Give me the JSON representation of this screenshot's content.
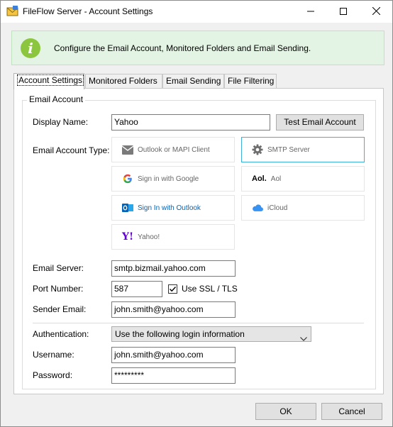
{
  "window": {
    "title": "FileFlow Server - Account Settings",
    "icons": {
      "app": "envelope-icon",
      "minimize": "minimize-icon",
      "maximize": "maximize-icon",
      "close": "close-icon"
    }
  },
  "banner": {
    "icon": "info-icon",
    "icon_glyph": "i",
    "text": "Configure the Email Account, Monitored Folders and Email Sending."
  },
  "tabs": [
    {
      "label": "Account Settings",
      "active": true
    },
    {
      "label": "Monitored Folders",
      "active": false
    },
    {
      "label": "Email Sending",
      "active": false
    },
    {
      "label": "File Filtering",
      "active": false
    }
  ],
  "email_account": {
    "group_label": "Email Account",
    "display_name_label": "Display Name:",
    "display_name_value": "Yahoo",
    "test_button_label": "Test Email Account",
    "account_type_label": "Email Account Type:",
    "account_types": [
      {
        "label": "Outlook or MAPI Client",
        "icon": "envelope-icon",
        "selected": false
      },
      {
        "label": "SMTP Server",
        "icon": "gear-icon",
        "selected": true
      },
      {
        "label": "Sign in with Google",
        "icon": "google-icon",
        "selected": false
      },
      {
        "label": "Aol",
        "icon": "aol-icon",
        "icon_text": "Aol.",
        "selected": false
      },
      {
        "label": "Sign In with Outlook",
        "icon": "outlook-icon",
        "selected": false
      },
      {
        "label": "iCloud",
        "icon": "icloud-icon",
        "selected": false
      },
      {
        "label": "Yahoo!",
        "icon": "yahoo-icon",
        "icon_text": "Y!",
        "selected": false
      }
    ],
    "server_label": "Email Server:",
    "server_value": "smtp.bizmail.yahoo.com",
    "port_label": "Port Number:",
    "port_value": "587",
    "ssl_label": "Use SSL / TLS",
    "ssl_checked": true,
    "sender_label": "Sender Email:",
    "sender_value": "john.smith@yahoo.com",
    "auth_label": "Authentication:",
    "auth_value": "Use the following login information",
    "username_label": "Username:",
    "username_value": "john.smith@yahoo.com",
    "password_label": "Password:",
    "password_value": "*********"
  },
  "footer": {
    "ok_label": "OK",
    "cancel_label": "Cancel"
  },
  "colors": {
    "banner_bg": "#e4f4e4",
    "info_green": "#8cc63e",
    "selected_border": "#3fb0d8",
    "yahoo_purple": "#6001d2",
    "outlook_blue": "#0364b8"
  }
}
